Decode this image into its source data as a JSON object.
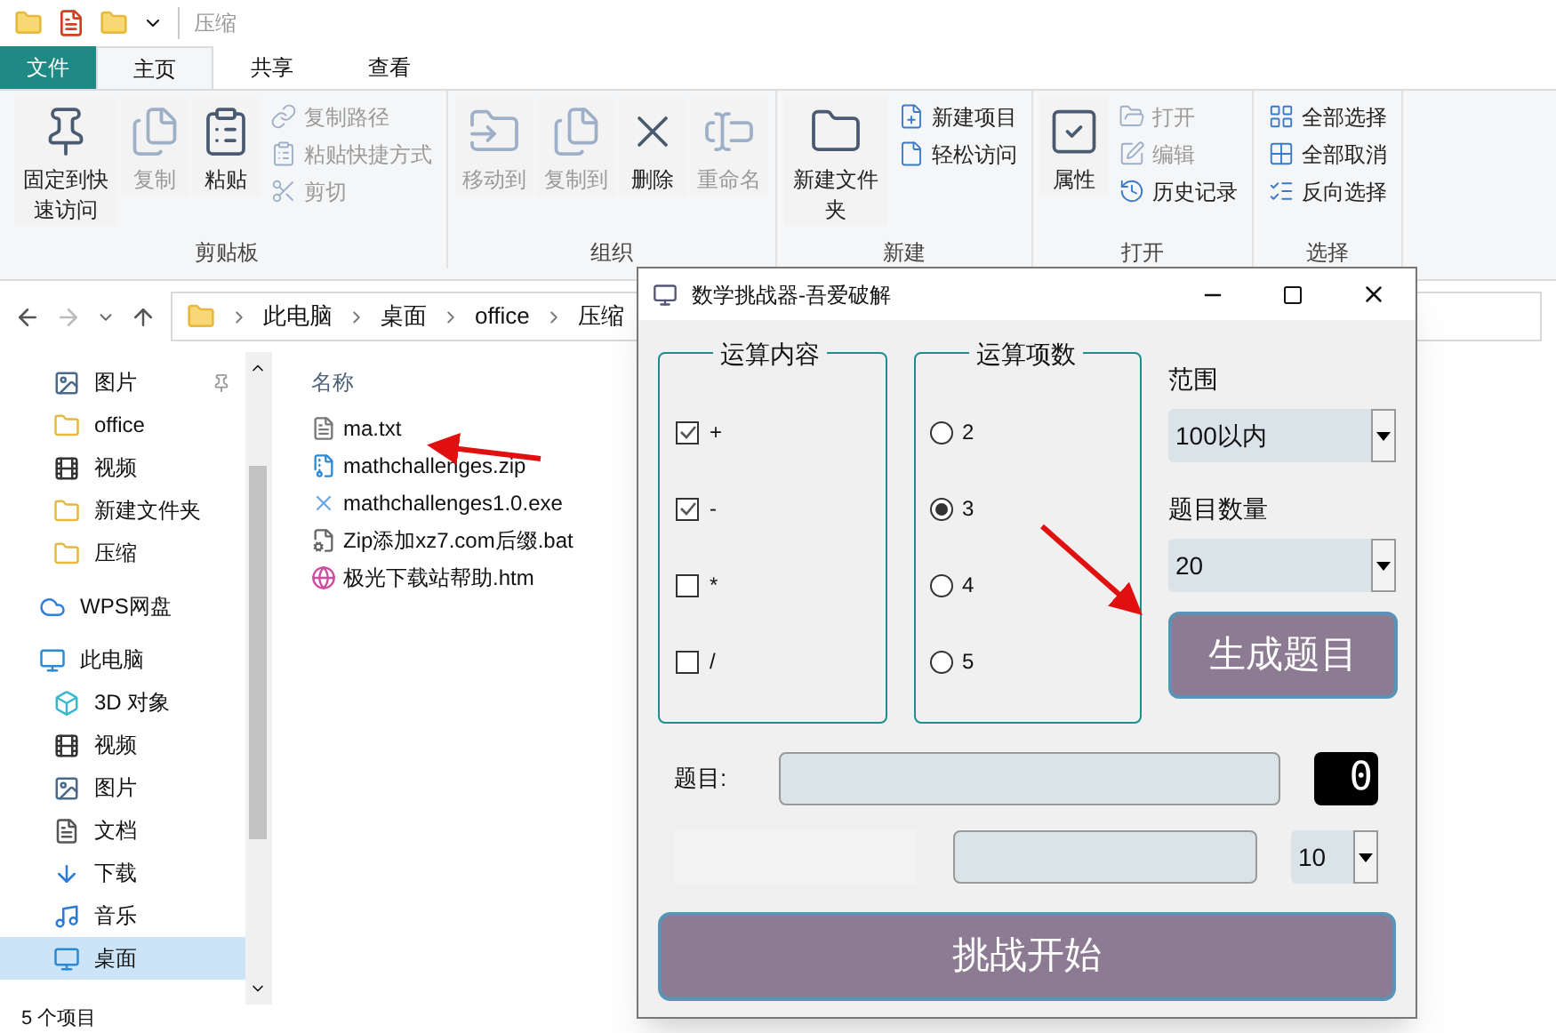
{
  "explorer": {
    "title": "压缩",
    "tabs": [
      {
        "label": "文件",
        "kind": "file",
        "selected": false
      },
      {
        "label": "主页",
        "kind": "tab",
        "selected": true
      },
      {
        "label": "共享",
        "kind": "tab",
        "selected": false
      },
      {
        "label": "查看",
        "kind": "tab",
        "selected": false
      }
    ],
    "ribbon": [
      {
        "label": "剪贴板",
        "items": [
          {
            "label": "固定到快速访问",
            "kind": "large",
            "disabled": false
          },
          {
            "label": "复制",
            "kind": "large",
            "disabled": true
          },
          {
            "label": "粘贴",
            "kind": "large",
            "disabled": false
          },
          {
            "label": "复制路径",
            "kind": "small",
            "disabled": true
          },
          {
            "label": "粘贴快捷方式",
            "kind": "small",
            "disabled": true
          },
          {
            "label": "剪切",
            "kind": "small",
            "disabled": true
          }
        ]
      },
      {
        "label": "组织",
        "items": [
          {
            "label": "移动到",
            "kind": "large",
            "disabled": true
          },
          {
            "label": "复制到",
            "kind": "large",
            "disabled": true
          },
          {
            "label": "删除",
            "kind": "large",
            "disabled": false
          },
          {
            "label": "重命名",
            "kind": "large",
            "disabled": true
          }
        ]
      },
      {
        "label": "新建",
        "items": [
          {
            "label": "新建文件夹",
            "kind": "large",
            "disabled": false
          },
          {
            "label": "新建项目",
            "kind": "small",
            "disabled": false
          },
          {
            "label": "轻松访问",
            "kind": "small",
            "disabled": false
          }
        ]
      },
      {
        "label": "打开",
        "items": [
          {
            "label": "属性",
            "kind": "large",
            "disabled": false
          },
          {
            "label": "打开",
            "kind": "small",
            "disabled": true
          },
          {
            "label": "编辑",
            "kind": "small",
            "disabled": true
          },
          {
            "label": "历史记录",
            "kind": "small",
            "disabled": false
          }
        ]
      },
      {
        "label": "选择",
        "items": [
          {
            "label": "全部选择",
            "kind": "small",
            "disabled": false
          },
          {
            "label": "全部取消",
            "kind": "small",
            "disabled": false
          },
          {
            "label": "反向选择",
            "kind": "small",
            "disabled": false
          }
        ]
      }
    ],
    "breadcrumb": [
      "此电脑",
      "桌面",
      "office",
      "压缩"
    ],
    "nav": [
      {
        "label": "图片",
        "kind": "image",
        "pinned": true,
        "selected": false
      },
      {
        "label": "office",
        "kind": "folder",
        "pinned": false,
        "selected": false
      },
      {
        "label": "视频",
        "kind": "video",
        "pinned": false,
        "selected": false
      },
      {
        "label": "新建文件夹",
        "kind": "folder",
        "pinned": false,
        "selected": false
      },
      {
        "label": "压缩",
        "kind": "folder",
        "pinned": false,
        "selected": false
      },
      {
        "label": "WPS网盘",
        "kind": "cloud",
        "pinned": false,
        "selected": false
      },
      {
        "label": "此电脑",
        "kind": "pc",
        "pinned": false,
        "selected": false
      },
      {
        "label": "3D 对象",
        "kind": "cube",
        "pinned": false,
        "selected": false
      },
      {
        "label": "视频",
        "kind": "video",
        "pinned": false,
        "selected": false
      },
      {
        "label": "图片",
        "kind": "image",
        "pinned": false,
        "selected": false
      },
      {
        "label": "文档",
        "kind": "doc",
        "pinned": false,
        "selected": false
      },
      {
        "label": "下载",
        "kind": "download",
        "pinned": false,
        "selected": false
      },
      {
        "label": "音乐",
        "kind": "music",
        "pinned": false,
        "selected": false
      },
      {
        "label": "桌面",
        "kind": "desktop",
        "pinned": false,
        "selected": true
      }
    ],
    "column": "名称",
    "files": [
      {
        "name": "ma.txt",
        "kind": "txt"
      },
      {
        "name": "mathchallenges.zip",
        "kind": "zip"
      },
      {
        "name": "mathchallenges1.0.exe",
        "kind": "exe"
      },
      {
        "name": "Zip添加xz7.com后缀.bat",
        "kind": "bat"
      },
      {
        "name": "极光下载站帮助.htm",
        "kind": "htm"
      }
    ],
    "status": "5 个项目"
  },
  "dialog": {
    "title": "数学挑战器-吾爱破解",
    "operations_title": "运算内容",
    "operations": [
      {
        "label": "+",
        "checked": true
      },
      {
        "label": "-",
        "checked": true
      },
      {
        "label": "*",
        "checked": false
      },
      {
        "label": "/",
        "checked": false
      }
    ],
    "terms_title": "运算项数",
    "terms": [
      {
        "label": "2",
        "selected": false
      },
      {
        "label": "3",
        "selected": true
      },
      {
        "label": "4",
        "selected": false
      },
      {
        "label": "5",
        "selected": false
      }
    ],
    "range_label": "范围",
    "range_value": "100以内",
    "count_label": "题目数量",
    "count_value": "20",
    "generate_button": "生成题目",
    "question_label": "题目:",
    "counter": "0",
    "time_value": "10",
    "start_button": "挑战开始"
  }
}
